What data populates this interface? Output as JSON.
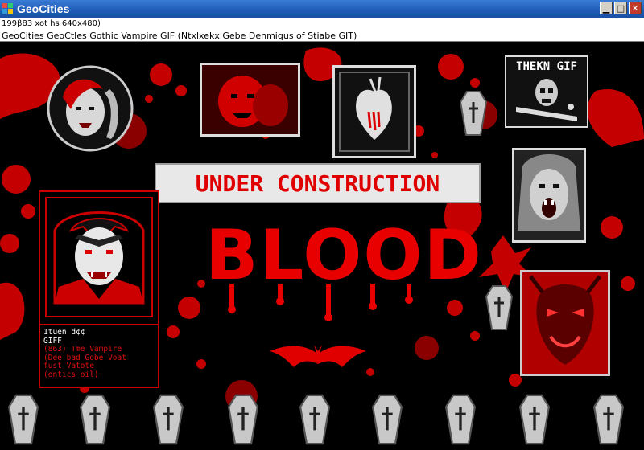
{
  "window": {
    "title": "GeoCities",
    "info": "199β83  xot hs  640x480)",
    "address": "GeoCities  GeoCtles  Gothic  Vampire  GIF  (Ntxlxekx  Gebe  Denmiqus  of  Stiabe  GIT)"
  },
  "banner": {
    "under_construction": "UNDER CONSTRUCTION",
    "blood": "BLOOD"
  },
  "thekn_gif": {
    "title": "THEKN GIF"
  },
  "infobox": {
    "lines_white": [
      "1tuen d¢¢",
      "GIFF"
    ],
    "lines_red": [
      "(863) Tme Vampire",
      "(Dee bad Gobe Voat",
      "fust Vatote",
      "(ontics oil)"
    ]
  },
  "colors": {
    "blood_red": "#e00000",
    "titlebar_blue": "#1f5bb8",
    "background": "#000000"
  },
  "icons": [
    "geocities-app-icon",
    "minimize-icon",
    "maximize-icon",
    "close-icon",
    "coffin-icon",
    "bat-icon",
    "cross-icon"
  ]
}
